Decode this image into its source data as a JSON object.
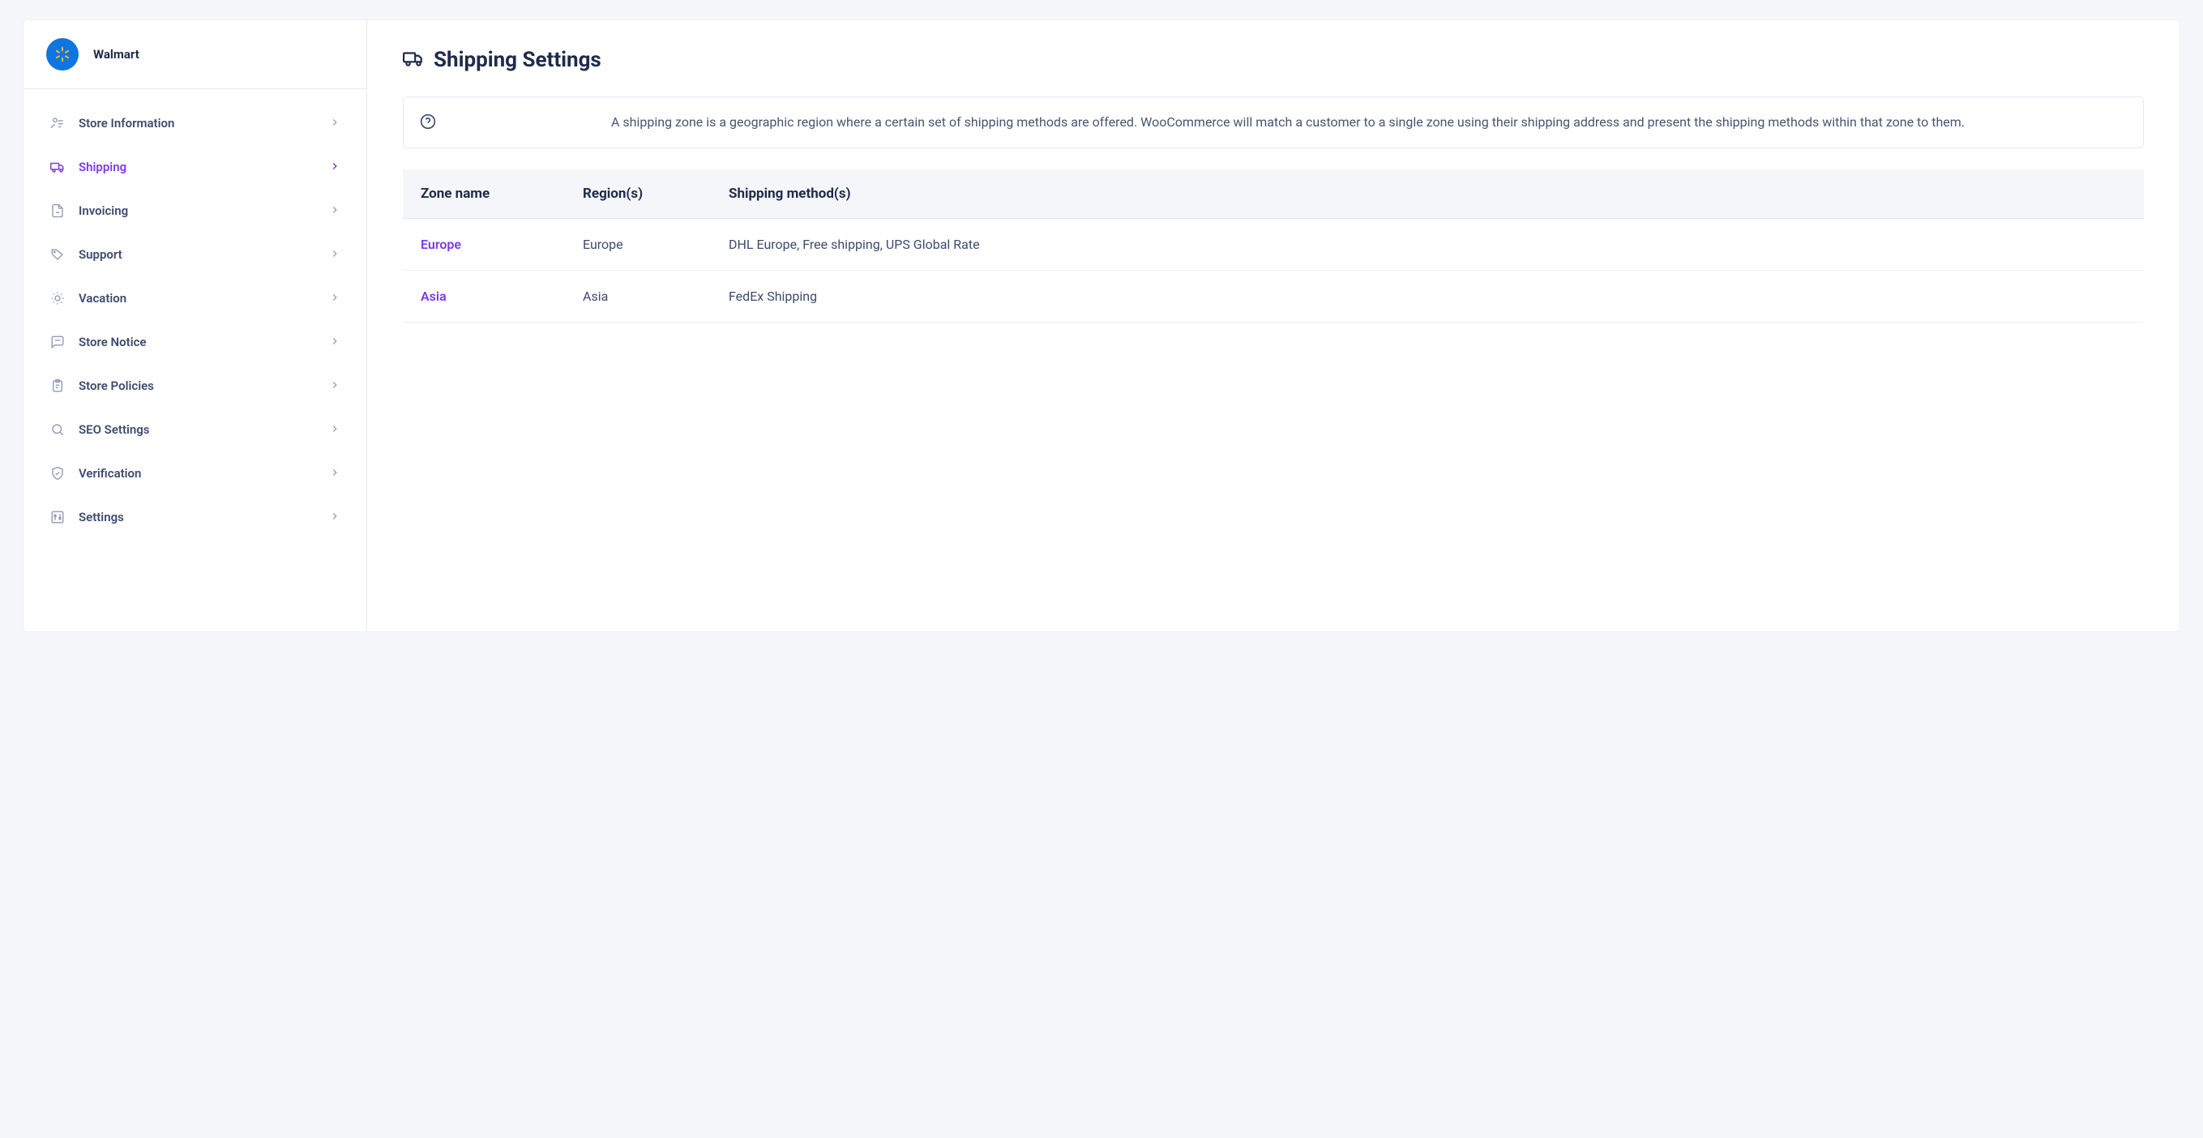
{
  "brand": {
    "name": "Walmart"
  },
  "sidebar": {
    "items": [
      {
        "label": "Store Information",
        "icon": "user-card-icon",
        "active": false
      },
      {
        "label": "Shipping",
        "icon": "truck-icon",
        "active": true
      },
      {
        "label": "Invoicing",
        "icon": "document-icon",
        "active": false
      },
      {
        "label": "Support",
        "icon": "tag-icon",
        "active": false
      },
      {
        "label": "Vacation",
        "icon": "sun-icon",
        "active": false
      },
      {
        "label": "Store Notice",
        "icon": "chat-icon",
        "active": false
      },
      {
        "label": "Store Policies",
        "icon": "clipboard-icon",
        "active": false
      },
      {
        "label": "SEO Settings",
        "icon": "search-icon",
        "active": false
      },
      {
        "label": "Verification",
        "icon": "shield-check-icon",
        "active": false
      },
      {
        "label": "Settings",
        "icon": "sliders-icon",
        "active": false
      }
    ]
  },
  "page": {
    "title": "Shipping Settings",
    "info": "A shipping zone is a geographic region where a certain set of shipping methods are offered. WooCommerce will match a customer to a single zone using their shipping address and present the shipping methods within that zone to them."
  },
  "table": {
    "columns": {
      "zone": "Zone name",
      "region": "Region(s)",
      "methods": "Shipping method(s)"
    },
    "rows": [
      {
        "zone": "Europe",
        "region": "Europe",
        "methods": "DHL Europe, Free shipping, UPS Global Rate"
      },
      {
        "zone": "Asia",
        "region": "Asia",
        "methods": "FedEx Shipping"
      }
    ]
  }
}
